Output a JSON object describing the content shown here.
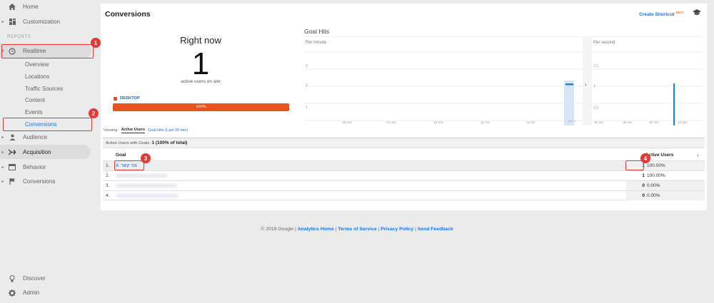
{
  "sidebar": {
    "home": "Home",
    "customization": "Customization",
    "reports_label": "REPORTS",
    "realtime": "Realtime",
    "realtime_sub": [
      "Overview",
      "Locations",
      "Traffic Sources",
      "Content",
      "Events",
      "Conversions"
    ],
    "audience": "Audience",
    "acquisition": "Acquisition",
    "behavior": "Behavior",
    "conversions": "Conversions",
    "discover": "Discover",
    "admin": "Admin"
  },
  "badges": [
    "1",
    "2",
    "3",
    "4"
  ],
  "header": {
    "title": "Conversions",
    "shortcut": "Create Shortcut",
    "shortcut_badge": "BETA"
  },
  "right_now": {
    "title": "Right now",
    "count": "1",
    "subtitle": "active users on site",
    "device": "DESKTOP",
    "device_pct": "100%"
  },
  "goal_hits": {
    "title": "Goal Hits",
    "per_minute": "Per minute",
    "per_second": "Per second",
    "minute_y_ticks": [
      "3",
      "2",
      "1"
    ],
    "second_y_ticks": [
      "1.5",
      "1",
      "0.5"
    ],
    "minute_x_ticks": [
      "-26 min",
      "-21 min",
      "-16 min",
      "-11 min",
      "-6 min",
      "min -1"
    ],
    "second_x_ticks": [
      "-60 sec",
      "-45 sec",
      "-30 sec",
      "-15 sec"
    ]
  },
  "viewing": {
    "label": "Viewing:",
    "active_tab": "Active Users",
    "other_tab": "Goal Hits (Last 30 min)"
  },
  "summary": {
    "label": "Active Users with Goals:",
    "value": "1 (100% of total)"
  },
  "table": {
    "col_goal": "Goal",
    "col_users": "Active Users",
    "rows": [
      {
        "num": "1.",
        "goal": "4: צור קשר",
        "value": "1",
        "pct": "100.00%"
      },
      {
        "num": "2.",
        "goal": "",
        "value": "1",
        "pct": "100.00%"
      },
      {
        "num": "3.",
        "goal": "",
        "value": "0",
        "pct": "0.00%"
      },
      {
        "num": "4.",
        "goal": "",
        "value": "0",
        "pct": "0.00%"
      }
    ]
  },
  "footer": {
    "copyright": "© 2019 Google |",
    "links": [
      "Analytics Home",
      "Terms of Service",
      "Privacy Policy",
      "Send Feedback"
    ],
    "sep": "|"
  },
  "colors": {
    "accent": "#1a73e8",
    "device_bar": "#e8541b",
    "annotation": "#e53935",
    "chart_bar": "#1e88c8"
  }
}
